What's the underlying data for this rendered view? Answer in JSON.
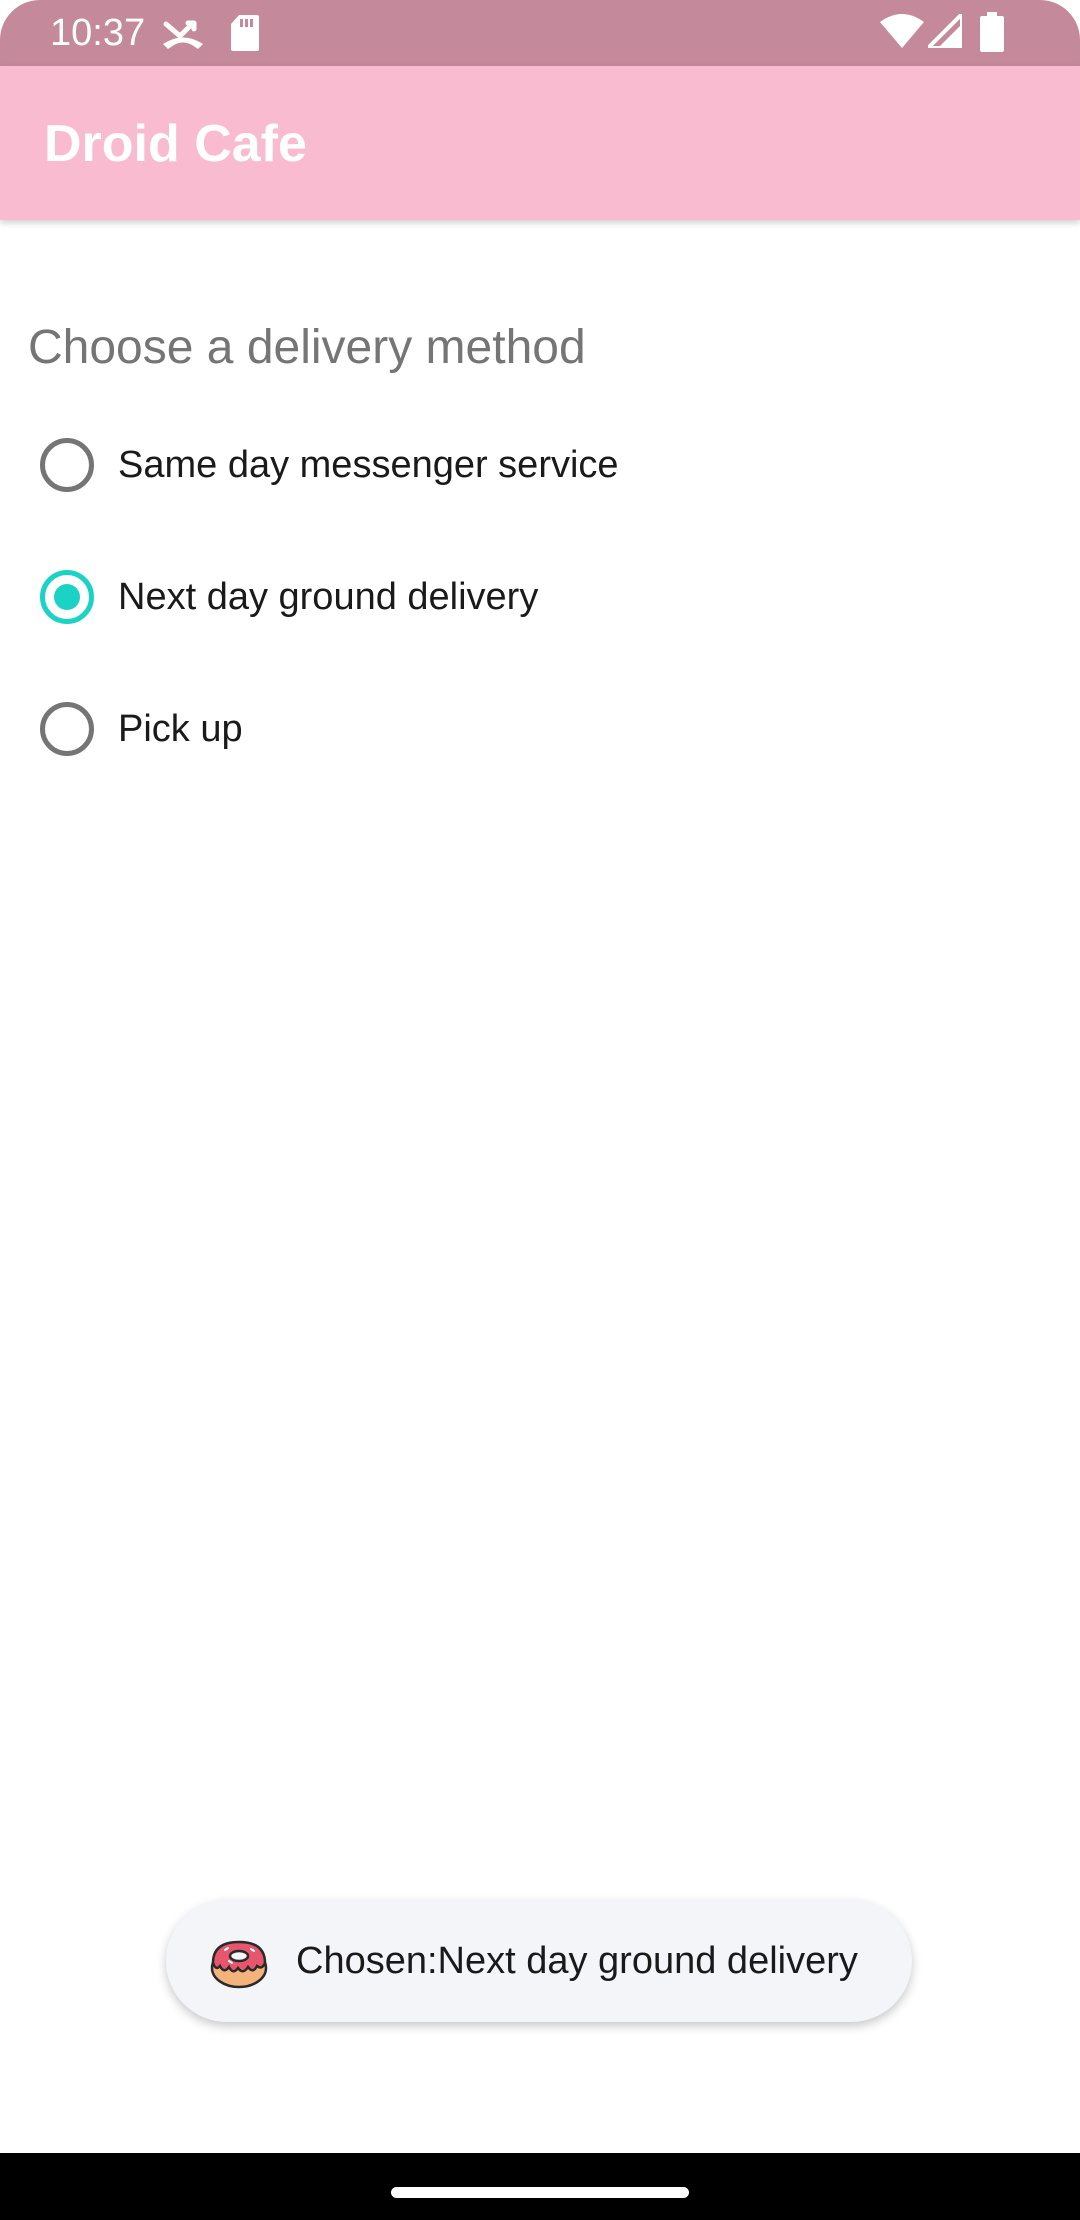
{
  "status_bar": {
    "time": "10:37",
    "icons": [
      "missed-call-icon",
      "sd-card-icon",
      "wifi-icon",
      "signal-icon",
      "battery-icon"
    ]
  },
  "app_bar": {
    "title": "Droid Cafe"
  },
  "delivery": {
    "heading": "Choose a delivery method",
    "options": [
      {
        "label": "Same day messenger service",
        "checked": false
      },
      {
        "label": "Next day ground delivery",
        "checked": true
      },
      {
        "label": "Pick up",
        "checked": false
      }
    ]
  },
  "toast": {
    "icon": "donut-icon",
    "text": "Chosen:Next day ground delivery"
  },
  "colors": {
    "status_bar": "#c4899a",
    "app_bar": "#f8bbd0",
    "accent": "#1ad3c4",
    "radio_unchecked": "#757575",
    "heading_text": "#757575",
    "toast_background": "#f4f5f9"
  }
}
